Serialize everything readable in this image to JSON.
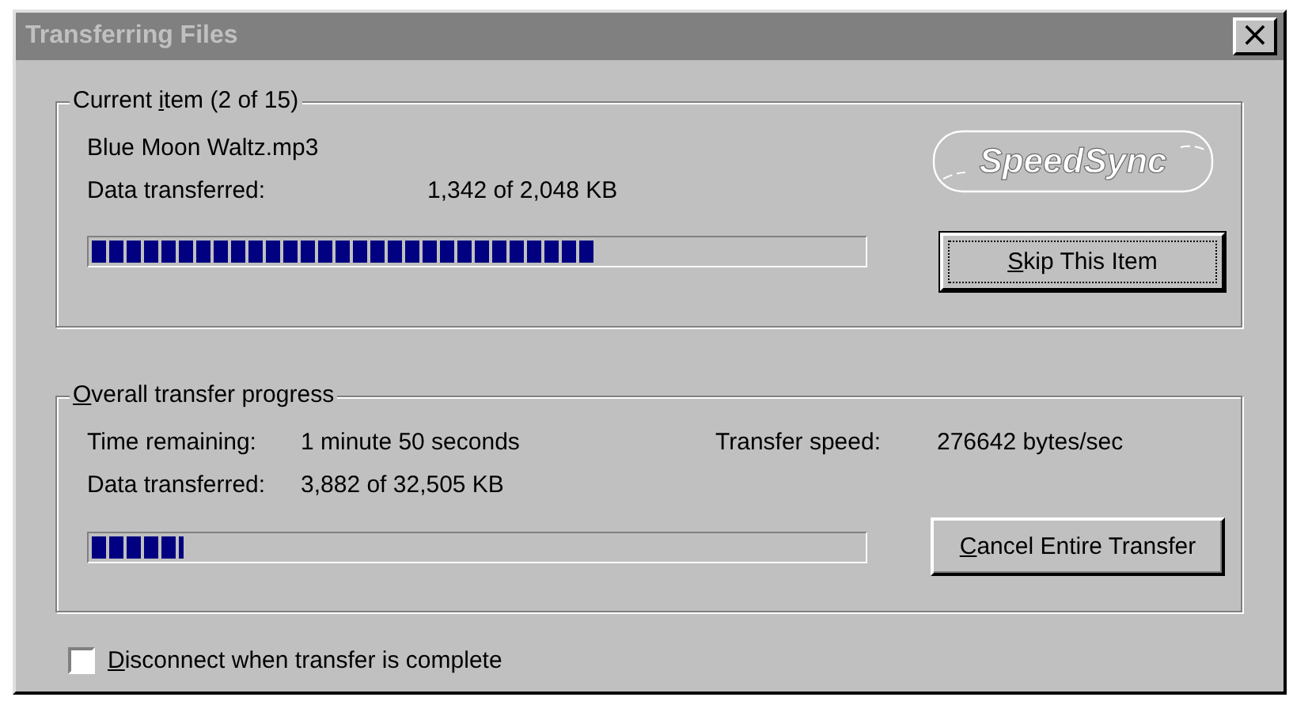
{
  "window": {
    "title": "Transferring Files",
    "close": "×"
  },
  "current_item": {
    "label": {
      "lead": "Current ",
      "key": "i",
      "rest": "tem (2 of 15)"
    },
    "file_name": "Blue Moon Waltz.mp3",
    "data_label": "Data transferred:",
    "data_value": "1,342 of 2,048 KB",
    "level": 0.655,
    "logo_text": "SpeedSync",
    "button": {
      "label": {
        "key": "S",
        "rest": "kip This Item"
      },
      "focused": true
    }
  },
  "overall": {
    "label": {
      "key": "O",
      "rest": "verall transfer progress"
    },
    "time_label": "Time remaining:",
    "time_value": "1 minute 50 seconds",
    "speed_label": "Transfer speed:",
    "speed_value": "276642 bytes/sec",
    "data_label": "Data transferred:",
    "data_value": "3,882 of 32,505 KB",
    "level": 0.12,
    "button": {
      "label": {
        "key": "C",
        "rest": "ancel Entire Transfer"
      },
      "focused": false
    }
  },
  "disconnect": {
    "label": {
      "key": "D",
      "rest": "isconnect when transfer is complete"
    },
    "checked": false
  }
}
